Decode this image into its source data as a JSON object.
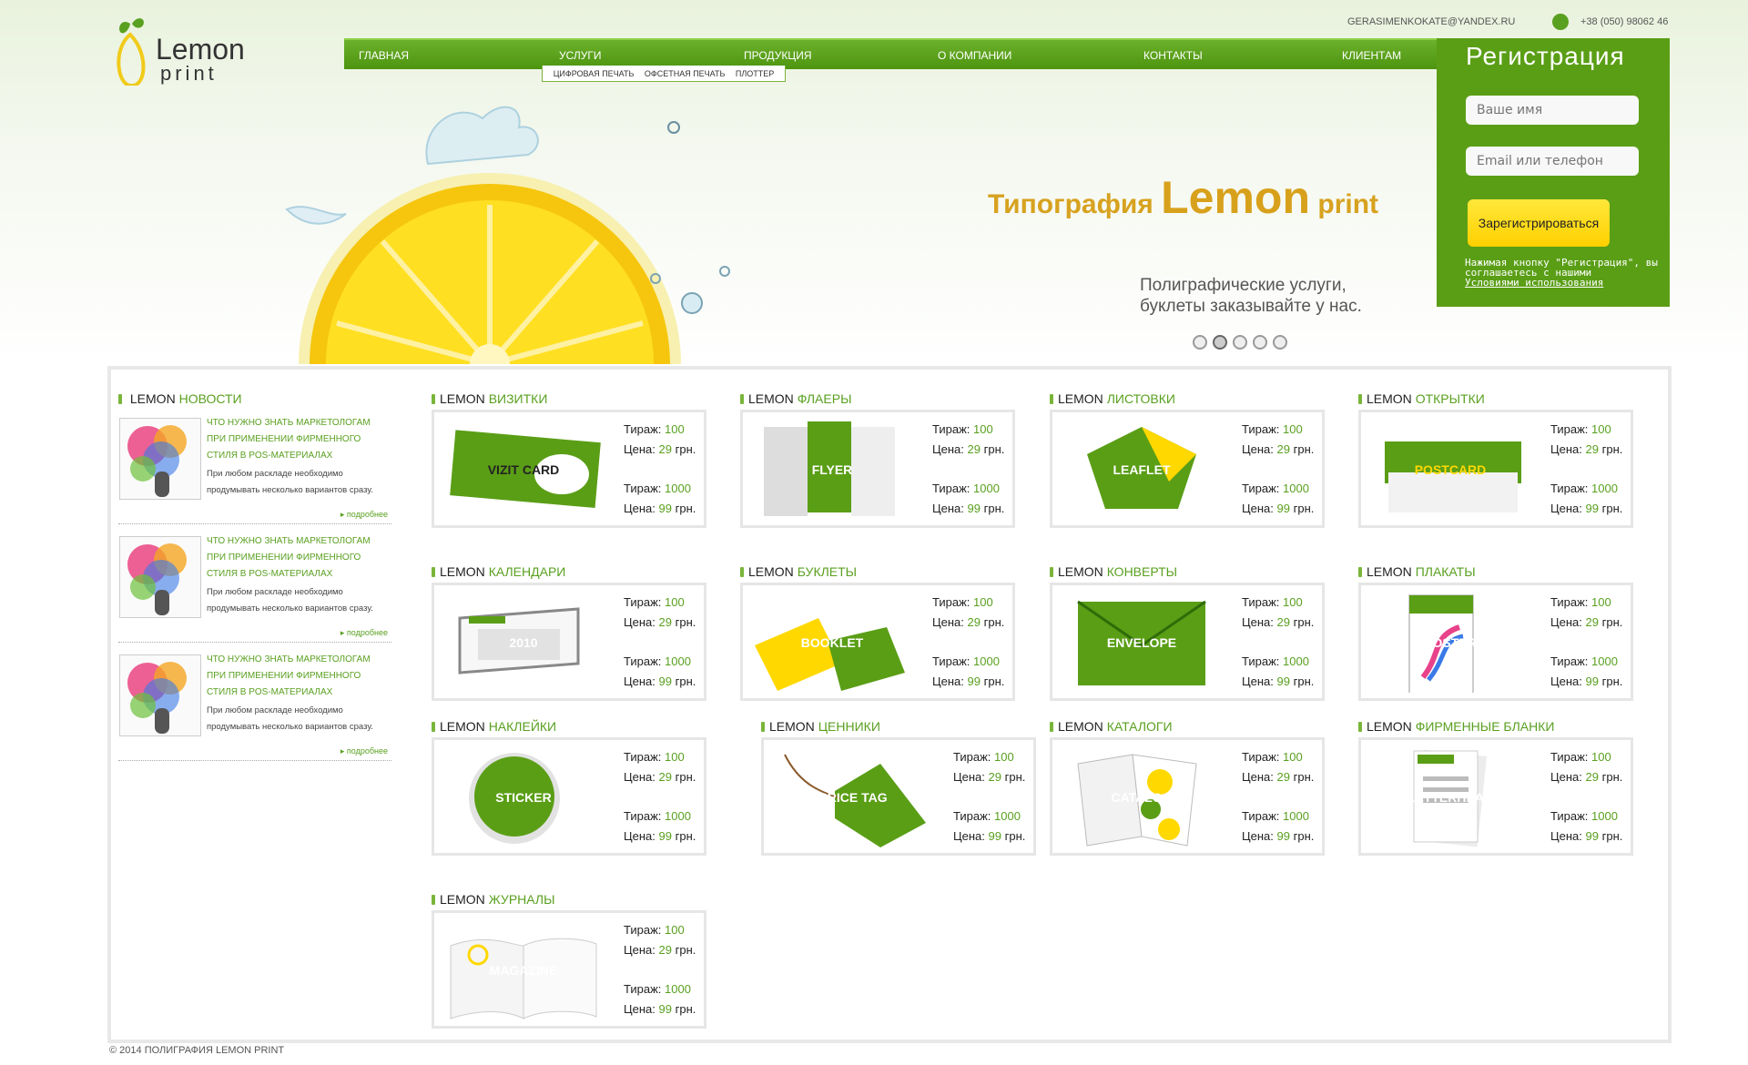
{
  "header": {
    "logo_line1": "Lemon",
    "logo_line2": "print",
    "email": "GERASIMENKOKATE@YANDEX.RU",
    "phone": "+38 (050) 98062 46"
  },
  "nav": {
    "items": [
      "ГЛАВНАЯ",
      "УСЛУГИ",
      "ПРОДУКЦИЯ",
      "О КОМПАНИИ",
      "КОНТАКТЫ",
      "КЛИЕНТАМ"
    ],
    "submenu": [
      "ЦИФРОВАЯ ПЕЧАТЬ",
      "ОФСЕТНАЯ ПЕЧАТЬ",
      "ПЛОТТЕР"
    ]
  },
  "hero": {
    "title_prefix": "Типография",
    "title_big": "Lemon",
    "title_suffix": "print",
    "subtitle_line1": "Полиграфические услуги,",
    "subtitle_line2": "буклеты заказывайте у нас.",
    "slides": 5,
    "active_slide": 2
  },
  "registration": {
    "title": "Регистрация",
    "name_placeholder": "Ваше имя",
    "contact_placeholder": "Email или телефон",
    "button": "Зарегистрироваться",
    "note": "Нажимая кнопку \"Регистрация\", вы соглашаетесь с нашими",
    "terms_link": "Условиями использования"
  },
  "news": {
    "prefix": "LEMON",
    "title": "НОВОСТИ",
    "items": [
      {
        "title": "ЧТО НУЖНО ЗНАТЬ МАРКЕТОЛОГАМ ПРИ ПРИМЕНЕНИИ ФИРМЕННОГО СТИЛЯ В POS-МАТЕРИАЛАХ",
        "text": "При любом раскладе необходимо продумывать несколько вариантов сразу.",
        "more": "подробнее"
      },
      {
        "title": "ЧТО НУЖНО ЗНАТЬ МАРКЕТОЛОГАМ ПРИ ПРИМЕНЕНИИ ФИРМЕННОГО СТИЛЯ В POS-МАТЕРИАЛАХ",
        "text": "При любом раскладе необходимо продумывать несколько вариантов сразу.",
        "more": "подробнее"
      },
      {
        "title": "ЧТО НУЖНО ЗНАТЬ МАРКЕТОЛОГАМ ПРИ ПРИМЕНЕНИИ ФИРМЕННОГО СТИЛЯ В POS-МАТЕРИАЛАХ",
        "text": "При любом раскладе необходимо продумывать несколько вариантов сразу.",
        "more": "подробнее"
      }
    ]
  },
  "spec_labels": {
    "qty": "Тираж:",
    "price": "Цена:",
    "currency": "грн."
  },
  "products": [
    {
      "name": "ВИЗИТКИ",
      "img_label": "VIZIT CARD",
      "qty1": "100",
      "price1": "29",
      "qty2": "1000",
      "price2": "99"
    },
    {
      "name": "ФЛАЕРЫ",
      "img_label": "FLYER",
      "qty1": "100",
      "price1": "29",
      "qty2": "1000",
      "price2": "99"
    },
    {
      "name": "ЛИСТОВКИ",
      "img_label": "LEAFLET",
      "qty1": "100",
      "price1": "29",
      "qty2": "1000",
      "price2": "99"
    },
    {
      "name": "ОТКРЫТКИ",
      "img_label": "POSTCARD",
      "qty1": "100",
      "price1": "29",
      "qty2": "1000",
      "price2": "99"
    },
    {
      "name": "КАЛЕНДАРИ",
      "img_label": "2010",
      "qty1": "100",
      "price1": "29",
      "qty2": "1000",
      "price2": "99"
    },
    {
      "name": "БУКЛЕТЫ",
      "img_label": "BOOKLET",
      "qty1": "100",
      "price1": "29",
      "qty2": "1000",
      "price2": "99"
    },
    {
      "name": "КОНВЕРТЫ",
      "img_label": "ENVELOPE",
      "qty1": "100",
      "price1": "29",
      "qty2": "1000",
      "price2": "99"
    },
    {
      "name": "ПЛАКАТЫ",
      "img_label": "POSTER",
      "qty1": "100",
      "price1": "29",
      "qty2": "1000",
      "price2": "99"
    },
    {
      "name": "НАКЛЕЙКИ",
      "img_label": "STICKER",
      "qty1": "100",
      "price1": "29",
      "qty2": "1000",
      "price2": "99"
    },
    {
      "name": "ЦЕННИКИ",
      "img_label": "PRICE TAG",
      "qty1": "100",
      "price1": "29",
      "qty2": "1000",
      "price2": "99"
    },
    {
      "name": "КАТАЛОГИ",
      "img_label": "CATALOG",
      "qty1": "100",
      "price1": "29",
      "qty2": "1000",
      "price2": "99"
    },
    {
      "name": "ФИРМЕННЫЕ БЛАНКИ",
      "img_label": "LETTERHEAD",
      "qty1": "100",
      "price1": "29",
      "qty2": "1000",
      "price2": "99"
    },
    {
      "name": "ЖУРНАЛЫ",
      "img_label": "MAGAZINE",
      "qty1": "100",
      "price1": "29",
      "qty2": "1000",
      "price2": "99"
    }
  ],
  "product_prefix": "LEMON",
  "footer": "© 2014 ПОЛИГРАФИЯ LEMON PRINT",
  "colors": {
    "accent": "#5a9e16",
    "yellow": "#ffd800",
    "nav": "#5fa31d"
  }
}
